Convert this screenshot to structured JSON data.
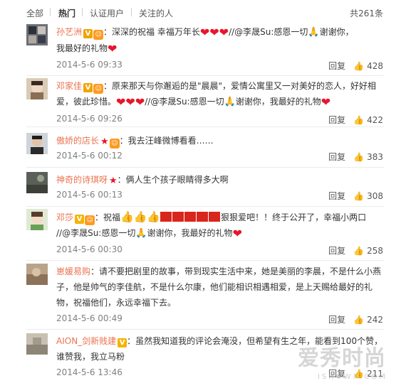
{
  "tabs": {
    "all": "全部",
    "hot": "热门",
    "verified": "认证用户",
    "following": "关注的人",
    "total": "共261条"
  },
  "actions": {
    "reply": "回复",
    "like_icon": "thumb-up-icon"
  },
  "comments": [
    {
      "user": "孙艺洲",
      "text1": "：深深的祝福 幸福万年长",
      "text2": "//@李晟Su:感恩一切",
      "text3": "谢谢你，",
      "text4": "我最好的礼物",
      "time": "2014-5-6 09:33",
      "likes": "428"
    },
    {
      "user": "邓家佳",
      "text1": "：原来那天与你邂逅的是\"晨晨\"，爱情公寓里又一对美好的恋人，好好相",
      "text2": "爱，彼此珍惜。",
      "text3": "//@李晟Su:感恩一切",
      "text4": "谢谢你，我最好的礼物",
      "time": "2014-5-6 09:26",
      "likes": "422"
    },
    {
      "user": "傲娇的店长",
      "text1": "：我去汪峰微博看看……",
      "time": "2014-5-6 00:12",
      "likes": "383"
    },
    {
      "user": "神奇的诗琪呀",
      "text1": "：俩人生个孩子眼睛得多大啊",
      "time": "2014-5-6 00:13",
      "likes": "308"
    },
    {
      "user": "邓莎",
      "text1": "：祝福",
      "text2": "狠狠爱吧！！终于公开了，幸福小两口",
      "text3": "//@李晟Su:感恩一切",
      "text4": "谢谢你，我最好的礼物",
      "time": "2014-5-6 00:30",
      "likes": "258"
    },
    {
      "user": "崽媛易购",
      "text1": "：请不要把剧里的故事，带到现实生活中来，她是美丽的李晨，不是什么小燕",
      "text2": "子，他是帅气的李佳航，不是什么尔康，他们能相识相遇相爱，是上天赐给最好的礼",
      "text3": "物，祝福他们，永远幸福下去。",
      "time": "2014-5-6 00:49",
      "likes": "242"
    },
    {
      "user": "AION_剑新贱建",
      "text1": "：虽然我知道我的评论会淹没，但希望有生之年，能看到100个赞，",
      "text2": "谁赞我，我立马粉",
      "time": "2014-5-6 13:46",
      "likes": "211"
    }
  ],
  "watermark": {
    "main": "爱秀时尚",
    "sub": "ISHOWX.COM"
  }
}
